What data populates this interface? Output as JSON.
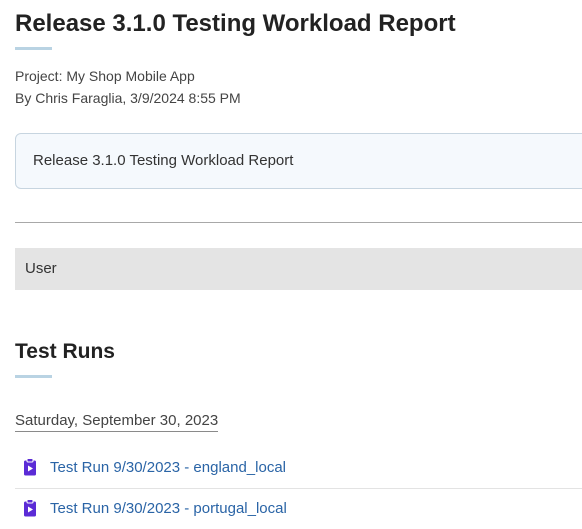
{
  "report": {
    "title": "Release 3.1.0 Testing Workload Report",
    "project_line": "Project: My Shop Mobile App",
    "author_line": "By Chris Faraglia, 3/9/2024 8:55 PM",
    "description": "Release 3.1.0 Testing Workload Report"
  },
  "grouping": {
    "label": "User"
  },
  "test_runs_section": {
    "heading": "Test Runs",
    "date_heading": "Saturday, September 30, 2023",
    "runs": [
      {
        "label": "Test Run 9/30/2023 - england_local",
        "icon": "test-run-icon"
      },
      {
        "label": "Test Run 9/30/2023 - portugal_local",
        "icon": "test-run-icon"
      }
    ]
  },
  "colors": {
    "link": "#2a64a6",
    "icon": "#5b2bd6",
    "accent_underline": "#b9d3e3",
    "group_bar": "#e4e4e4",
    "description_bg": "#f5f9fd"
  }
}
